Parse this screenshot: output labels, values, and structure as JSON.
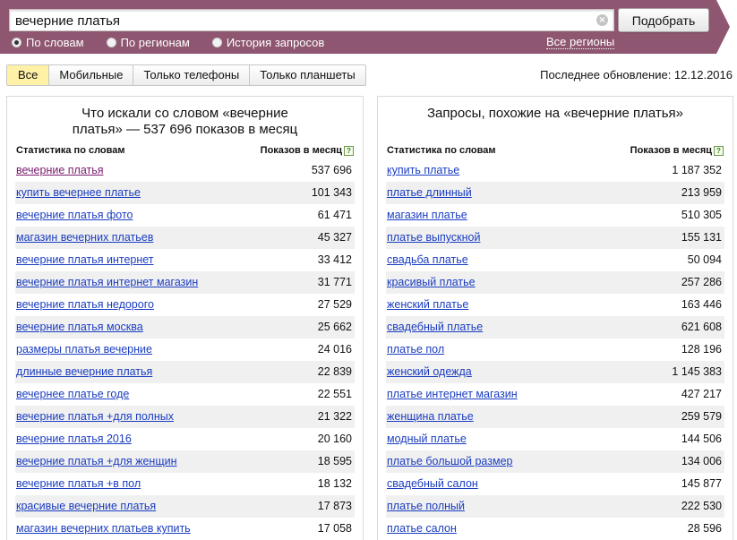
{
  "search": {
    "query": "вечерние платья",
    "button_label": "Подобрать",
    "clear_glyph": "×"
  },
  "modes": [
    {
      "label": "По словам",
      "selected": true
    },
    {
      "label": "По регионам",
      "selected": false
    },
    {
      "label": "История запросов",
      "selected": false
    }
  ],
  "regions_link": "Все регионы",
  "tabs": [
    {
      "label": "Все",
      "active": true
    },
    {
      "label": "Мобильные",
      "active": false
    },
    {
      "label": "Только телефоны",
      "active": false
    },
    {
      "label": "Только планшеты",
      "active": false
    }
  ],
  "last_update": "Последнее обновление: 12.12.2016",
  "colors": {
    "band": "#8e5670",
    "link": "#1a3dc1",
    "visited_link": "#7a1a6f",
    "active_tab": "#fff1a6"
  },
  "left_panel": {
    "title": "Что искали со словом «вечерние платья» — 537 696 показов в месяц",
    "col_words": "Статистика по словам",
    "col_shows": "Показов в месяц",
    "help_glyph": "?",
    "rows": [
      {
        "q": "вечерние платья",
        "n": "537 696",
        "visited": true
      },
      {
        "q": "купить вечернее платье",
        "n": "101 343"
      },
      {
        "q": "вечерние платья фото",
        "n": "61 471"
      },
      {
        "q": "магазин вечерних платьев",
        "n": "45 327"
      },
      {
        "q": "вечерние платья интернет",
        "n": "33 412"
      },
      {
        "q": "вечерние платья интернет магазин",
        "n": "31 771"
      },
      {
        "q": "вечерние платья недорого",
        "n": "27 529"
      },
      {
        "q": "вечерние платья москва",
        "n": "25 662"
      },
      {
        "q": "размеры платья вечерние",
        "n": "24 016"
      },
      {
        "q": "длинные вечерние платья",
        "n": "22 839"
      },
      {
        "q": "вечернее платье годе",
        "n": "22 551"
      },
      {
        "q": "вечерние платья +для полных",
        "n": "21 322"
      },
      {
        "q": "вечерние платья 2016",
        "n": "20 160"
      },
      {
        "q": "вечерние платья +для женщин",
        "n": "18 595"
      },
      {
        "q": "вечерние платья +в пол",
        "n": "18 132"
      },
      {
        "q": "красивые вечерние платья",
        "n": "17 873"
      },
      {
        "q": "магазин вечерних платьев купить",
        "n": "17 058"
      }
    ]
  },
  "right_panel": {
    "title": "Запросы, похожие на «вечерние платья»",
    "col_words": "Статистика по словам",
    "col_shows": "Показов в месяц",
    "help_glyph": "?",
    "rows": [
      {
        "q": "купить платье",
        "n": "1 187 352"
      },
      {
        "q": "платье длинный",
        "n": "213 959"
      },
      {
        "q": "магазин платье",
        "n": "510 305"
      },
      {
        "q": "платье выпускной",
        "n": "155 131"
      },
      {
        "q": "свадьба платье",
        "n": "50 094"
      },
      {
        "q": "красивый платье",
        "n": "257 286"
      },
      {
        "q": "женский платье",
        "n": "163 446"
      },
      {
        "q": "свадебный платье",
        "n": "621 608"
      },
      {
        "q": "платье пол",
        "n": "128 196"
      },
      {
        "q": "женский одежда",
        "n": "1 145 383"
      },
      {
        "q": "платье интернет магазин",
        "n": "427 217"
      },
      {
        "q": "женщина платье",
        "n": "259 579"
      },
      {
        "q": "модный платье",
        "n": "144 506"
      },
      {
        "q": "платье большой размер",
        "n": "134 006"
      },
      {
        "q": "свадебный салон",
        "n": "145 877"
      },
      {
        "q": "платье полный",
        "n": "222 530"
      },
      {
        "q": "платье салон",
        "n": "28 596"
      }
    ]
  }
}
